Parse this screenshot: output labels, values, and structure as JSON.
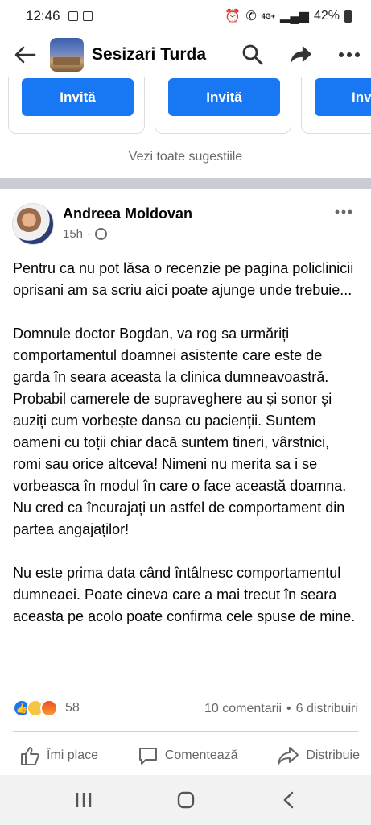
{
  "status_bar": {
    "time": "12:46",
    "network": "4G+",
    "battery": "42%"
  },
  "header": {
    "title": "Sesizari Turda",
    "icons": [
      "back-arrow-icon",
      "search-icon",
      "share-icon",
      "more-icon"
    ]
  },
  "suggestions": {
    "invite_label": "Invită",
    "invite_label_partial": "Inv",
    "see_all": "Vezi toate sugestiile"
  },
  "post": {
    "author": "Andreea Moldovan",
    "time": "15h",
    "paragraphs": [
      "Pentru ca nu pot lăsa o recenzie pe pagina policlinicii oprisani am sa scriu aici poate ajunge unde trebuie...",
      "Domnule doctor Bogdan, va rog sa urmăriți comportamentul doamnei asistente care este de garda în seara aceasta la clinica dumneavoastră. Probabil camerele de supraveghere au și sonor și auziți cum vorbește dansa cu pacienții. Suntem oameni cu toții chiar dacă suntem tineri, vârstnici, romi sau orice altceva! Nimeni nu merita sa i se vorbeasca în modul în care o face această doamna. Nu cred ca încurajați un astfel de comportament din partea angajaților!",
      "Nu este prima data când întâlnesc comportamentul dumneaei. Poate cineva care a mai trecut în seara aceasta pe acolo poate confirma cele spuse de mine."
    ],
    "reaction_count": "58",
    "comments": "10 comentarii",
    "shares": "6 distribuiri",
    "separator": "•",
    "meta_separator": "·"
  },
  "actions": {
    "like": "Îmi place",
    "comment": "Comentează",
    "share": "Distribuie"
  },
  "colors": {
    "accent": "#1877f2",
    "secondary_text": "#65676b",
    "divider": "#c9ccd1"
  }
}
